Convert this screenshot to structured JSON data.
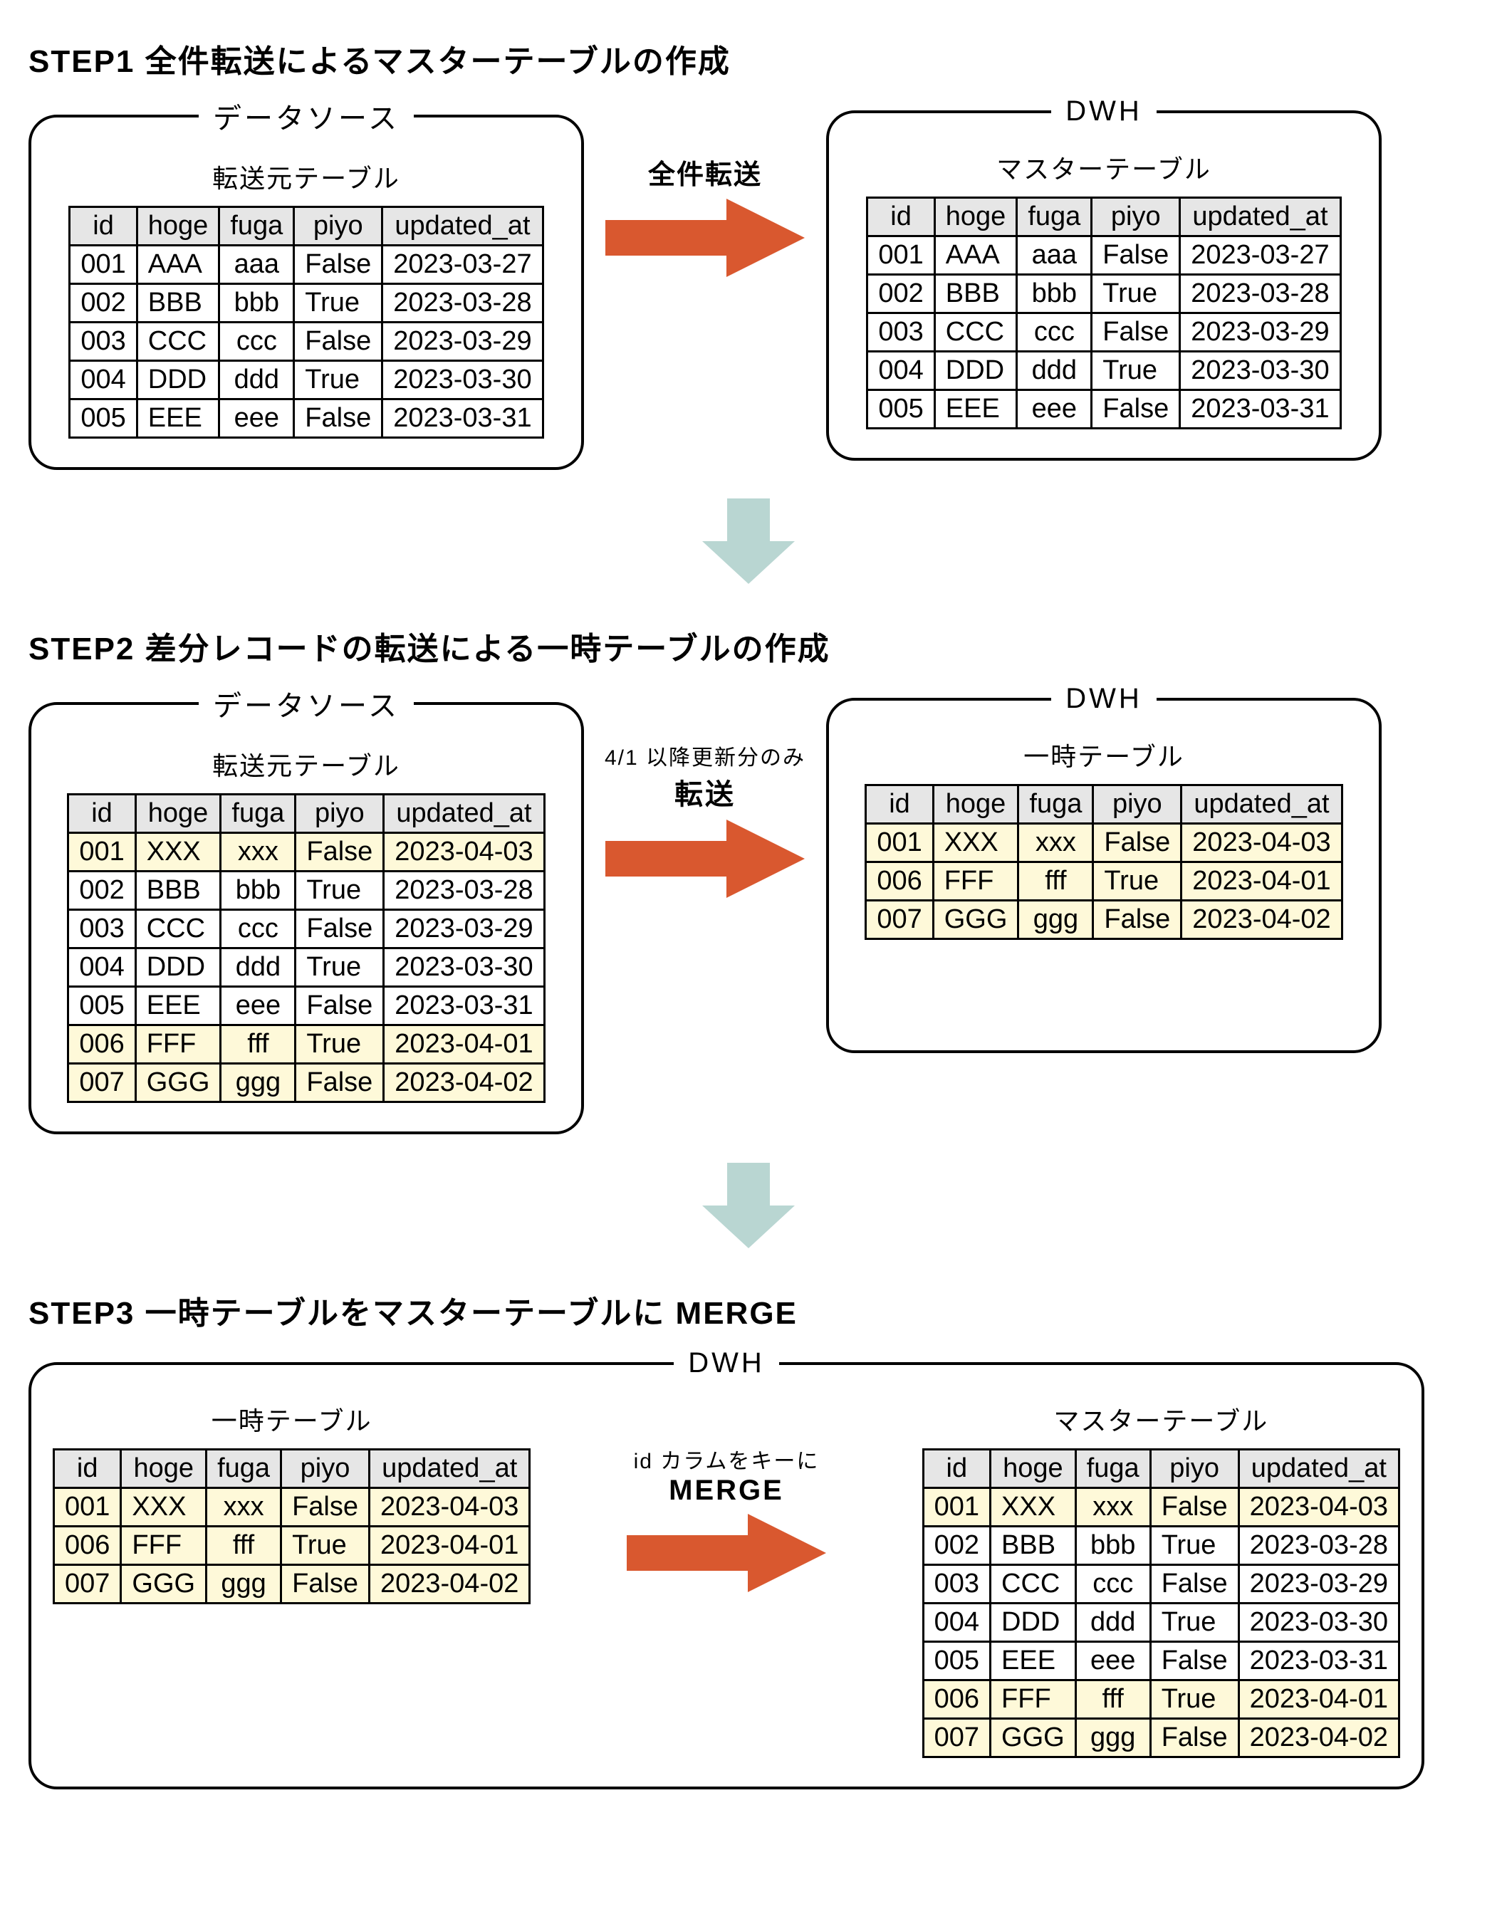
{
  "columns": [
    "id",
    "hoge",
    "fuga",
    "piyo",
    "updated_at"
  ],
  "step1": {
    "title": "STEP1 全件転送によるマスターテーブルの作成",
    "left_legend": "データソース",
    "left_subtitle": "転送元テーブル",
    "right_legend": "DWH",
    "right_subtitle": "マスターテーブル",
    "arrow_label": "全件転送",
    "left_rows": [
      {
        "id": "001",
        "hoge": "AAA",
        "fuga": "aaa",
        "piyo": "False",
        "updated_at": "2023-03-27",
        "hl": false
      },
      {
        "id": "002",
        "hoge": "BBB",
        "fuga": "bbb",
        "piyo": "True",
        "updated_at": "2023-03-28",
        "hl": false
      },
      {
        "id": "003",
        "hoge": "CCC",
        "fuga": "ccc",
        "piyo": "False",
        "updated_at": "2023-03-29",
        "hl": false
      },
      {
        "id": "004",
        "hoge": "DDD",
        "fuga": "ddd",
        "piyo": "True",
        "updated_at": "2023-03-30",
        "hl": false
      },
      {
        "id": "005",
        "hoge": "EEE",
        "fuga": "eee",
        "piyo": "False",
        "updated_at": "2023-03-31",
        "hl": false
      }
    ],
    "right_rows": [
      {
        "id": "001",
        "hoge": "AAA",
        "fuga": "aaa",
        "piyo": "False",
        "updated_at": "2023-03-27",
        "hl": false
      },
      {
        "id": "002",
        "hoge": "BBB",
        "fuga": "bbb",
        "piyo": "True",
        "updated_at": "2023-03-28",
        "hl": false
      },
      {
        "id": "003",
        "hoge": "CCC",
        "fuga": "ccc",
        "piyo": "False",
        "updated_at": "2023-03-29",
        "hl": false
      },
      {
        "id": "004",
        "hoge": "DDD",
        "fuga": "ddd",
        "piyo": "True",
        "updated_at": "2023-03-30",
        "hl": false
      },
      {
        "id": "005",
        "hoge": "EEE",
        "fuga": "eee",
        "piyo": "False",
        "updated_at": "2023-03-31",
        "hl": false
      }
    ]
  },
  "step2": {
    "title": "STEP2 差分レコードの転送による一時テーブルの作成",
    "left_legend": "データソース",
    "left_subtitle": "転送元テーブル",
    "right_legend": "DWH",
    "right_subtitle": "一時テーブル",
    "arrow_label_small": "4/1 以降更新分のみ",
    "arrow_label_big": "転送",
    "left_rows": [
      {
        "id": "001",
        "hoge": "XXX",
        "fuga": "xxx",
        "piyo": "False",
        "updated_at": "2023-04-03",
        "hl": true
      },
      {
        "id": "002",
        "hoge": "BBB",
        "fuga": "bbb",
        "piyo": "True",
        "updated_at": "2023-03-28",
        "hl": false
      },
      {
        "id": "003",
        "hoge": "CCC",
        "fuga": "ccc",
        "piyo": "False",
        "updated_at": "2023-03-29",
        "hl": false
      },
      {
        "id": "004",
        "hoge": "DDD",
        "fuga": "ddd",
        "piyo": "True",
        "updated_at": "2023-03-30",
        "hl": false
      },
      {
        "id": "005",
        "hoge": "EEE",
        "fuga": "eee",
        "piyo": "False",
        "updated_at": "2023-03-31",
        "hl": false
      },
      {
        "id": "006",
        "hoge": "FFF",
        "fuga": "fff",
        "piyo": "True",
        "updated_at": "2023-04-01",
        "hl": true
      },
      {
        "id": "007",
        "hoge": "GGG",
        "fuga": "ggg",
        "piyo": "False",
        "updated_at": "2023-04-02",
        "hl": true
      }
    ],
    "right_rows": [
      {
        "id": "001",
        "hoge": "XXX",
        "fuga": "xxx",
        "piyo": "False",
        "updated_at": "2023-04-03",
        "hl": true
      },
      {
        "id": "006",
        "hoge": "FFF",
        "fuga": "fff",
        "piyo": "True",
        "updated_at": "2023-04-01",
        "hl": true
      },
      {
        "id": "007",
        "hoge": "GGG",
        "fuga": "ggg",
        "piyo": "False",
        "updated_at": "2023-04-02",
        "hl": true
      }
    ]
  },
  "step3": {
    "title": "STEP3 一時テーブルをマスターテーブルに MERGE",
    "legend": "DWH",
    "left_subtitle": "一時テーブル",
    "right_subtitle": "マスターテーブル",
    "arrow_label_small": "id カラムをキーに",
    "arrow_label_big": "MERGE",
    "left_rows": [
      {
        "id": "001",
        "hoge": "XXX",
        "fuga": "xxx",
        "piyo": "False",
        "updated_at": "2023-04-03",
        "hl": true
      },
      {
        "id": "006",
        "hoge": "FFF",
        "fuga": "fff",
        "piyo": "True",
        "updated_at": "2023-04-01",
        "hl": true
      },
      {
        "id": "007",
        "hoge": "GGG",
        "fuga": "ggg",
        "piyo": "False",
        "updated_at": "2023-04-02",
        "hl": true
      }
    ],
    "right_rows": [
      {
        "id": "001",
        "hoge": "XXX",
        "fuga": "xxx",
        "piyo": "False",
        "updated_at": "2023-04-03",
        "hl": true
      },
      {
        "id": "002",
        "hoge": "BBB",
        "fuga": "bbb",
        "piyo": "True",
        "updated_at": "2023-03-28",
        "hl": false
      },
      {
        "id": "003",
        "hoge": "CCC",
        "fuga": "ccc",
        "piyo": "False",
        "updated_at": "2023-03-29",
        "hl": false
      },
      {
        "id": "004",
        "hoge": "DDD",
        "fuga": "ddd",
        "piyo": "True",
        "updated_at": "2023-03-30",
        "hl": false
      },
      {
        "id": "005",
        "hoge": "EEE",
        "fuga": "eee",
        "piyo": "False",
        "updated_at": "2023-03-31",
        "hl": false
      },
      {
        "id": "006",
        "hoge": "FFF",
        "fuga": "fff",
        "piyo": "True",
        "updated_at": "2023-04-01",
        "hl": true
      },
      {
        "id": "007",
        "hoge": "GGG",
        "fuga": "ggg",
        "piyo": "False",
        "updated_at": "2023-04-02",
        "hl": true
      }
    ]
  },
  "colors": {
    "arrow_orange": "#d9582f",
    "arrow_teal": "#b9d6d2",
    "header_bg": "#e6e6e6",
    "highlight_bg": "#fef9d9"
  }
}
